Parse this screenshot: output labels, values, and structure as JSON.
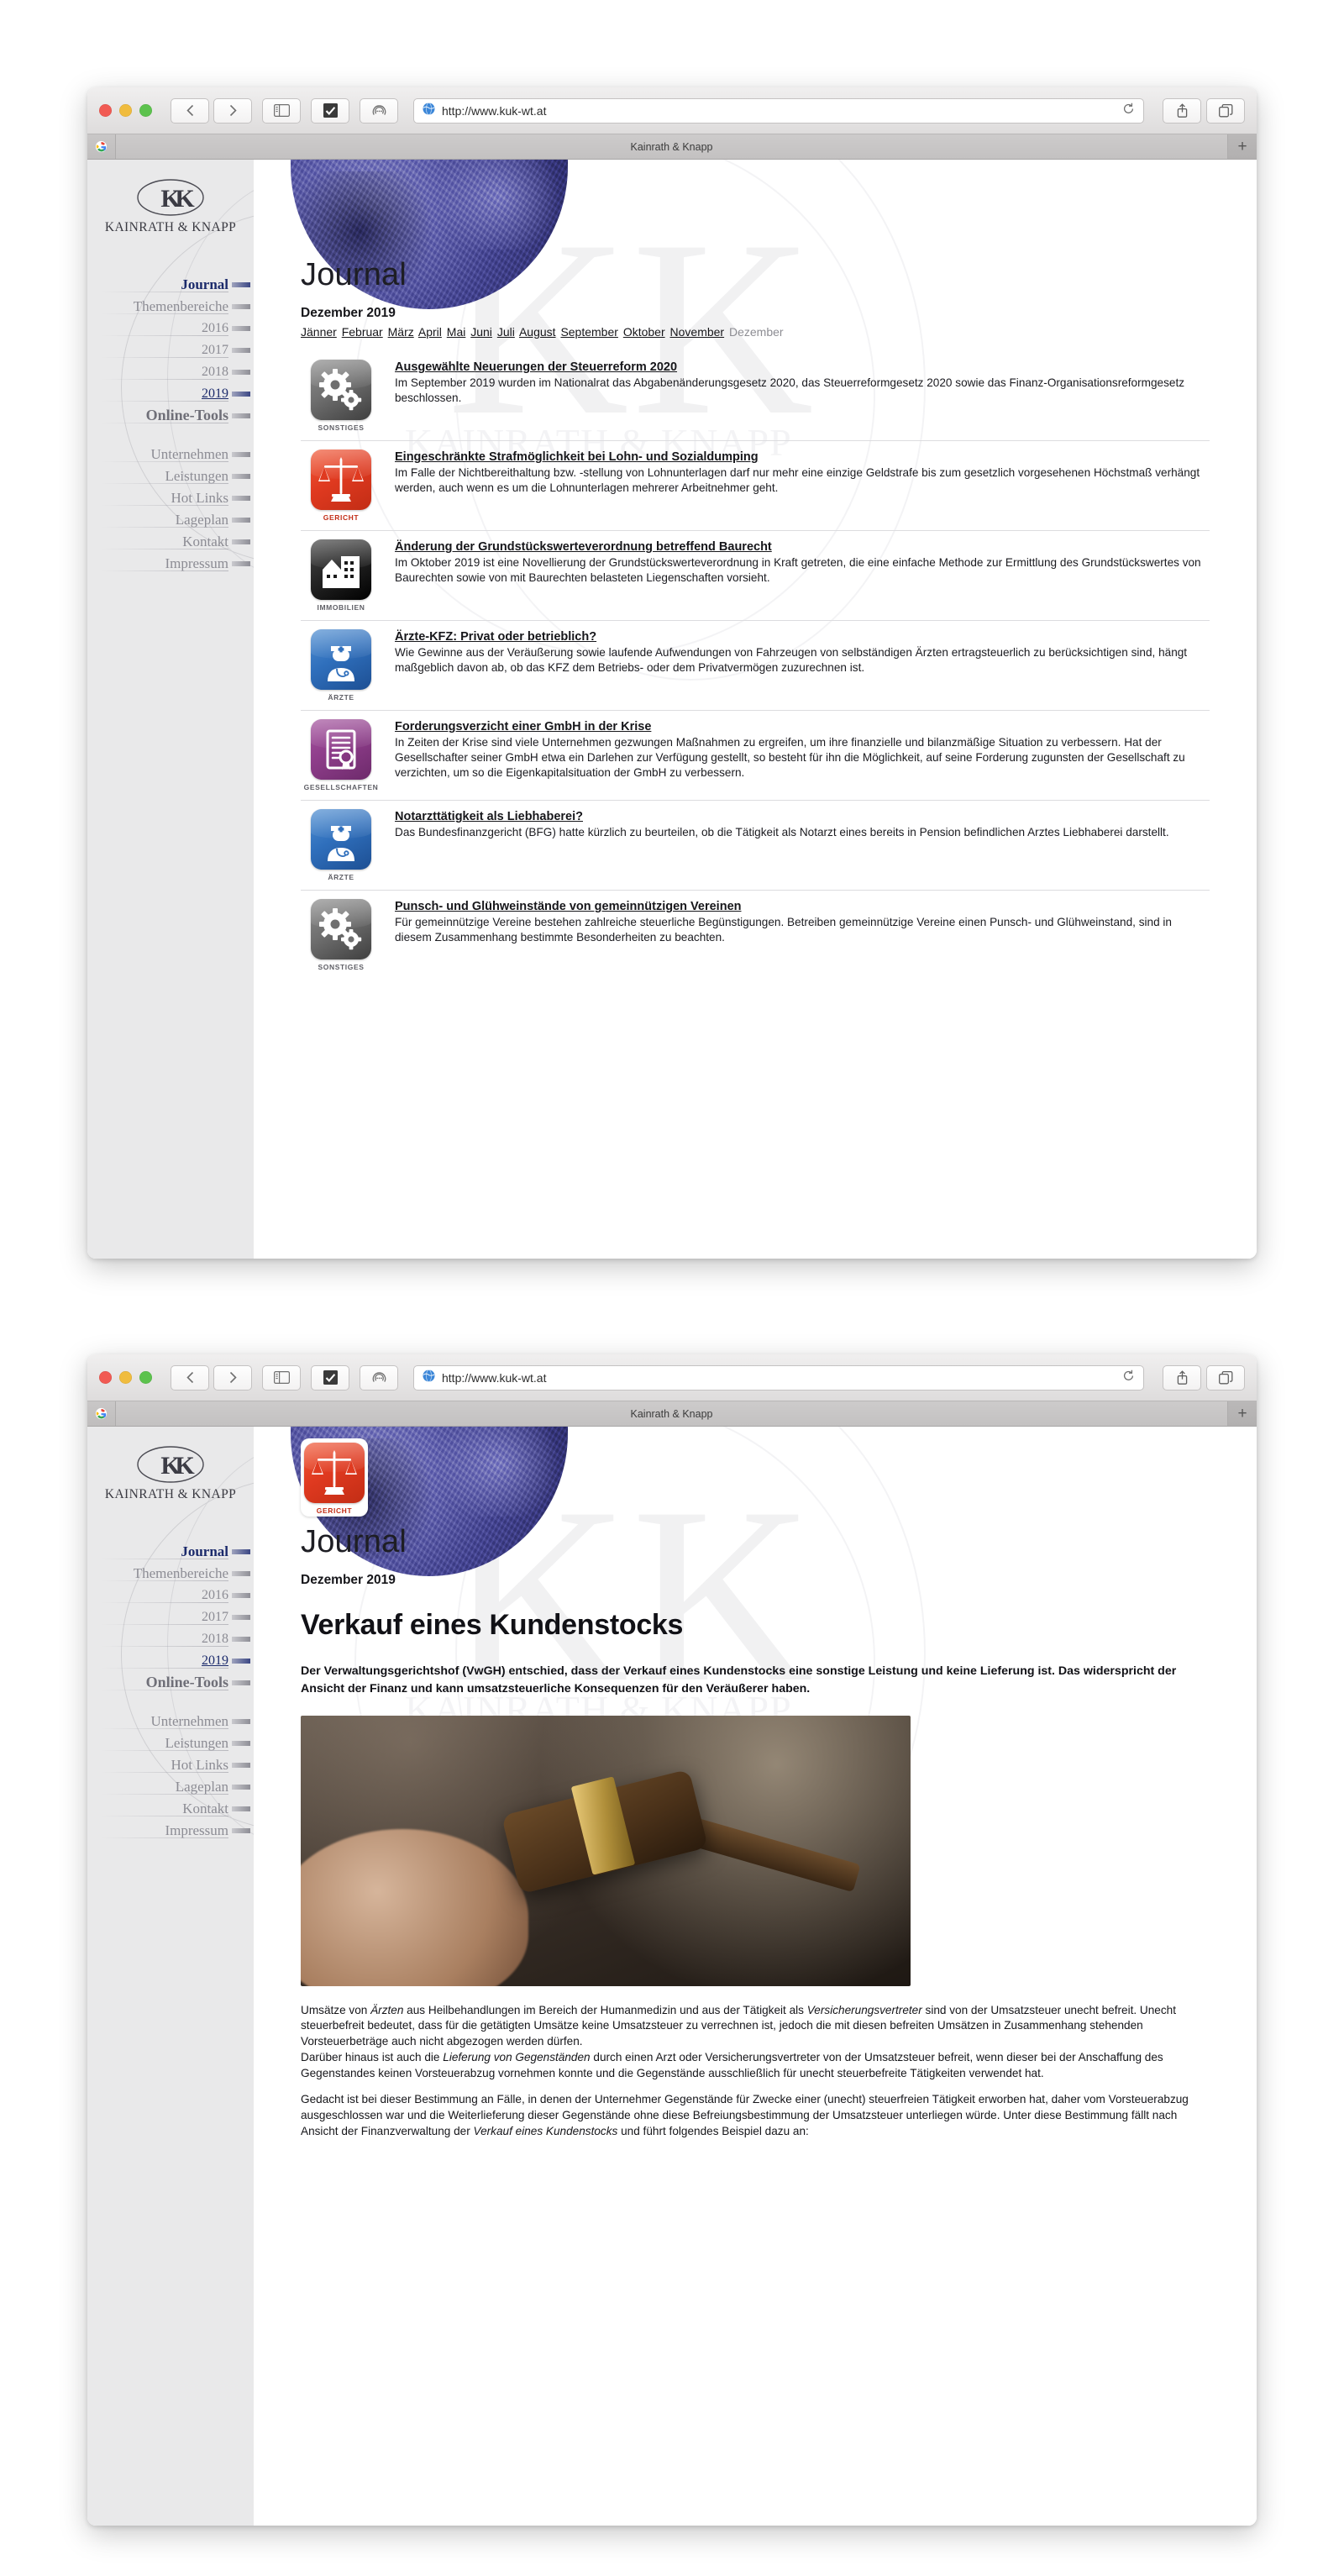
{
  "browser": {
    "url": "http://www.kuk-wt.at",
    "tab_title": "Kainrath & Knapp",
    "back_icon": "‹",
    "forward_icon": "›",
    "sidebar_icon": "sidebar",
    "reader_icon": "✔",
    "share_pill_icon": "◎",
    "reload_icon": "⟳",
    "upload_icon": "⇪",
    "tabs_icon": "❐",
    "newtab_icon": "+",
    "favicon_icon": "G"
  },
  "site": {
    "brand": "KAINRATH & KNAPP",
    "nav": [
      {
        "label": "Journal",
        "type": "active"
      },
      {
        "label": "Themenbereiche",
        "type": "normal"
      },
      {
        "label": "2016",
        "type": "year"
      },
      {
        "label": "2017",
        "type": "year"
      },
      {
        "label": "2018",
        "type": "year"
      },
      {
        "label": "2019",
        "type": "year-selected"
      },
      {
        "label": "Online-Tools",
        "type": "strong"
      },
      {
        "label": "Unternehmen",
        "type": "normal"
      },
      {
        "label": "Leistungen",
        "type": "normal"
      },
      {
        "label": "Hot Links",
        "type": "normal"
      },
      {
        "label": "Lageplan",
        "type": "normal"
      },
      {
        "label": "Kontakt",
        "type": "normal"
      },
      {
        "label": "Impressum",
        "type": "normal"
      }
    ]
  },
  "journal": {
    "title": "Journal",
    "issue": "Dezember 2019",
    "months": [
      {
        "label": "Jänner",
        "current": false
      },
      {
        "label": "Februar",
        "current": false
      },
      {
        "label": "März",
        "current": false
      },
      {
        "label": "April",
        "current": false
      },
      {
        "label": "Mai",
        "current": false
      },
      {
        "label": "Juni",
        "current": false
      },
      {
        "label": "Juli",
        "current": false
      },
      {
        "label": "August",
        "current": false
      },
      {
        "label": "September",
        "current": false
      },
      {
        "label": "Oktober",
        "current": false
      },
      {
        "label": "November",
        "current": false
      },
      {
        "label": "Dezember",
        "current": true
      }
    ],
    "articles": [
      {
        "category": "SONSTIGES",
        "icon": "gears-icon",
        "title": "Ausgewählte Neuerungen der Steuerreform 2020",
        "text": "Im September 2019 wurden im Nationalrat das Abgabenänderungsgesetz 2020, das Steuerreformgesetz 2020 sowie das Finanz-Organisationsreformgesetz beschlossen."
      },
      {
        "category": "GERICHT",
        "icon": "scales-icon",
        "title": "Eingeschränkte Strafmöglichkeit bei Lohn- und Sozialdumping",
        "text": "Im Falle der Nichtbereithaltung bzw. -stellung von Lohnunterlagen darf nur mehr eine einzige Geldstrafe bis zum gesetzlich vorgesehenen Höchstmaß verhängt werden, auch wenn es um die Lohnunterlagen mehrerer Arbeitnehmer geht."
      },
      {
        "category": "IMMOBILIEN",
        "icon": "buildings-icon",
        "title": "Änderung der Grundstückswerteverordnung betreffend Baurecht",
        "text": "Im Oktober 2019 ist eine Novellierung der Grundstückswerteverordnung in Kraft getreten, die eine einfache Methode zur Ermittlung des Grundstückswertes von Baurechten sowie von mit Baurechten belasteten Liegenschaften vorsieht."
      },
      {
        "category": "ÄRZTE",
        "icon": "doctor-icon",
        "title": "Ärzte-KFZ: Privat oder betrieblich?",
        "text": "Wie Gewinne aus der Veräußerung sowie laufende Aufwendungen von Fahrzeugen von selbständigen Ärzten ertragsteuerlich zu berücksichtigen sind, hängt maßgeblich davon ab, ob das KFZ dem Betriebs- oder dem Privatvermögen zuzurechnen ist."
      },
      {
        "category": "GESELLSCHAFTEN",
        "icon": "certificate-icon",
        "title": "Forderungsverzicht einer GmbH in der Krise",
        "text": "In Zeiten der Krise sind viele Unternehmen gezwungen Maßnahmen zu ergreifen, um ihre finanzielle und bilanzmäßige Situation zu verbessern. Hat der Gesellschafter seiner GmbH etwa ein Darlehen zur Verfügung gestellt, so besteht für ihn die Möglichkeit, auf seine Forderung zugunsten der Gesellschaft zu verzichten, um so die Eigenkapitalsituation der GmbH zu verbessern."
      },
      {
        "category": "ÄRZTE",
        "icon": "doctor-icon",
        "title": "Notarzttätigkeit als Liebhaberei?",
        "text": "Das Bundesfinanzgericht (BFG) hatte kürzlich zu beurteilen, ob die Tätigkeit als Notarzt eines bereits in Pension befindlichen Arztes Liebhaberei darstellt."
      },
      {
        "category": "SONSTIGES",
        "icon": "gears-icon",
        "title": "Punsch- und Glühweinstände von gemeinnützigen Vereinen",
        "text": "Für gemeinnützige Vereine bestehen zahlreiche steuerliche Begünstigungen. Betreiben gemeinnützige Vereine einen Punsch- und Glühweinstand, sind in diesem Zusammenhang bestimmte Besonderheiten zu beachten."
      }
    ]
  },
  "detail": {
    "category": "GERICHT",
    "icon": "scales-icon",
    "journal_title": "Journal",
    "issue": "Dezember 2019",
    "title": "Verkauf eines Kundenstocks",
    "lead": "Der Verwaltungsgerichtshof (VwGH) entschied, dass der Verkauf eines Kundenstocks eine sonstige Leistung und keine Lieferung ist. Das widerspricht der Ansicht der Finanz und kann umsatzsteuerliche Konsequenzen für den Veräußerer haben.",
    "photo_alt": "richterhammer-foto",
    "paragraph_1_a": "Umsätze von ",
    "paragraph_1_em1": "Ärzten",
    "paragraph_1_b": " aus Heilbehandlungen im Bereich der Humanmedizin und aus der Tätigkeit als ",
    "paragraph_1_em2": "Versicherungsvertreter",
    "paragraph_1_c": " sind von der Umsatzsteuer unecht befreit. Unecht steuerbefreit bedeutet, dass für die getätigten Umsätze keine Umsatzsteuer zu verrechnen ist, jedoch die mit diesen befreiten Umsätzen in Zusammenhang stehenden Vorsteuerbeträge auch nicht abgezogen werden dürfen.",
    "paragraph_2_a": "Darüber hinaus ist auch die ",
    "paragraph_2_em": "Lieferung von Gegenständen",
    "paragraph_2_b": " durch einen Arzt oder Versicherungsvertreter von der Umsatzsteuer befreit, wenn dieser bei der Anschaffung des Gegenstandes keinen Vorsteuerabzug vornehmen konnte und die Gegenstände ausschließlich für unecht steuerbefreite Tätigkeiten verwendet hat.",
    "paragraph_3_a": "Gedacht ist bei dieser Bestimmung an Fälle, in denen der Unternehmer Gegenstände für Zwecke einer (unecht) steuerfreien Tätigkeit erworben hat, daher vom Vorsteuerabzug ausgeschlossen war und die Weiterlieferung dieser Gegenstände ohne diese Befreiungsbestimmung der Umsatzsteuer unterliegen würde. Unter diese Bestimmung fällt nach Ansicht der Finanzverwaltung der ",
    "paragraph_3_em": "Verkauf eines Kundenstocks",
    "paragraph_3_b": " und führt folgendes Beispiel dazu an:"
  },
  "colors": {
    "accent_blue": "#1b2a6b",
    "gericht_red": "#c22d15",
    "gesellschaften_purple": "#8e3d8a",
    "aerzte_blue": "#2f6fbc"
  }
}
